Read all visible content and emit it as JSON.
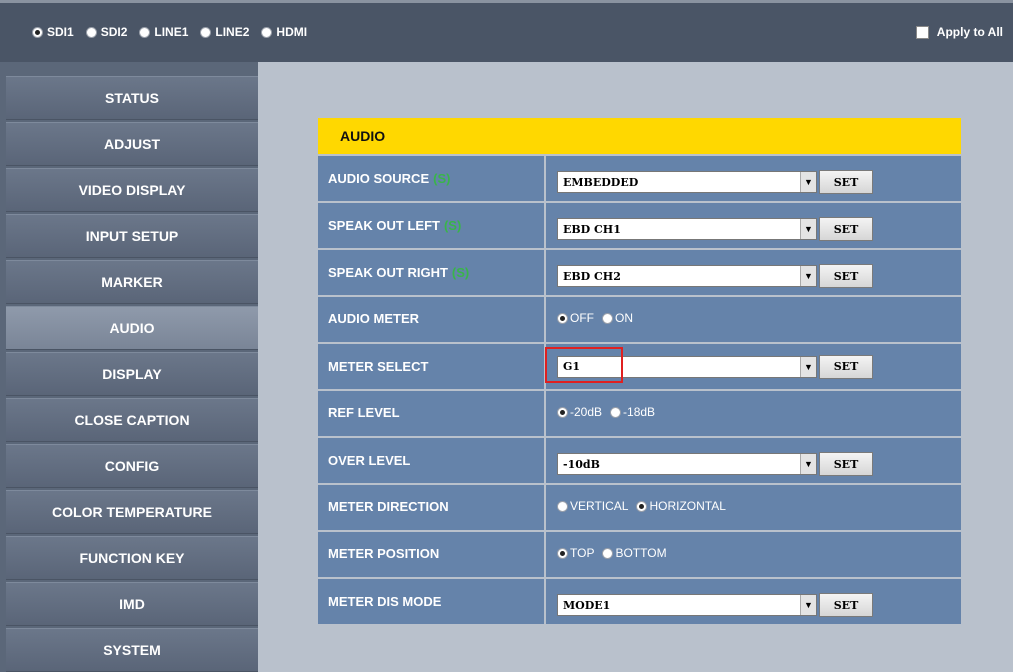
{
  "topbar": {
    "sources": [
      {
        "label": "SDI1",
        "selected": true
      },
      {
        "label": "SDI2",
        "selected": false
      },
      {
        "label": "LINE1",
        "selected": false
      },
      {
        "label": "LINE2",
        "selected": false
      },
      {
        "label": "HDMI",
        "selected": false
      }
    ],
    "apply_all_label": "Apply to All"
  },
  "sidebar": {
    "items": [
      {
        "label": "STATUS"
      },
      {
        "label": "ADJUST"
      },
      {
        "label": "VIDEO DISPLAY"
      },
      {
        "label": "INPUT SETUP"
      },
      {
        "label": "MARKER"
      },
      {
        "label": "AUDIO",
        "active": true
      },
      {
        "label": "DISPLAY"
      },
      {
        "label": "CLOSE CAPTION"
      },
      {
        "label": "CONFIG"
      },
      {
        "label": "COLOR TEMPERATURE"
      },
      {
        "label": "FUNCTION KEY"
      },
      {
        "label": "IMD"
      },
      {
        "label": "SYSTEM"
      }
    ]
  },
  "panel": {
    "title": "AUDIO",
    "s_tag": "(S)",
    "set_label": "SET",
    "rows": {
      "audio_source": {
        "label": "AUDIO SOURCE",
        "value": "EMBEDDED"
      },
      "speak_out_left": {
        "label": "SPEAK OUT LEFT",
        "value": "EBD CH1"
      },
      "speak_out_right": {
        "label": "SPEAK OUT RIGHT",
        "value": "EBD CH2"
      },
      "audio_meter": {
        "label": "AUDIO METER",
        "options": [
          "OFF",
          "ON"
        ],
        "selected": "OFF"
      },
      "meter_select": {
        "label": "METER SELECT",
        "value": "G1"
      },
      "ref_level": {
        "label": "REF LEVEL",
        "options": [
          "-20dB",
          "-18dB"
        ],
        "selected": "-20dB"
      },
      "over_level": {
        "label": "OVER LEVEL",
        "value": "-10dB"
      },
      "meter_direction": {
        "label": "METER DIRECTION",
        "options": [
          "VERTICAL",
          "HORIZONTAL"
        ],
        "selected": "HORIZONTAL"
      },
      "meter_position": {
        "label": "METER POSITION",
        "options": [
          "TOP",
          "BOTTOM"
        ],
        "selected": "TOP"
      },
      "meter_dis_mode": {
        "label": "METER DIS MODE",
        "value": "MODE1"
      }
    }
  },
  "colors": {
    "title_bar": "#ffd800",
    "row_bg": "#6583aa",
    "s_tag": "#39b54a",
    "highlight": "#e02020"
  }
}
